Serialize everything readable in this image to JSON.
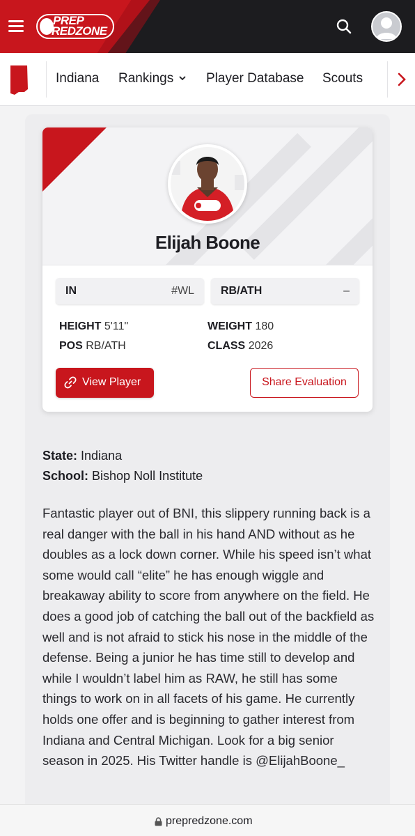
{
  "header": {
    "logo_line1": "PREP",
    "logo_line2": "REDZONE",
    "menu_icon": "hamburger-menu-icon",
    "search_icon": "search-icon",
    "avatar_icon": "user-avatar-icon"
  },
  "nav": {
    "state_icon": "indiana-state-icon",
    "items": [
      {
        "label": "Indiana"
      },
      {
        "label": "Rankings",
        "icon": "chevron-down-icon"
      },
      {
        "label": "Player Database"
      },
      {
        "label": "Scouts"
      }
    ],
    "next_icon": "chevron-right-icon"
  },
  "player": {
    "name": "Elijah Boone",
    "state_abbr": "IN",
    "state_rank": "#WL",
    "position_chip": "RB/ATH",
    "position_rank": "–",
    "height_label": "HEIGHT",
    "height": "5'11\"",
    "weight_label": "WEIGHT",
    "weight": "180",
    "pos_label": "POS",
    "pos": "RB/ATH",
    "class_label": "CLASS",
    "class": "2026",
    "jersey_text": "PREP REDZONE"
  },
  "actions": {
    "view_player": "View Player",
    "share_evaluation": "Share Evaluation"
  },
  "details": {
    "state_label": "State:",
    "state": "Indiana",
    "school_label": "School:",
    "school": "Bishop Noll Institute"
  },
  "evaluation": "Fantastic player out of BNI, this slippery running back is a real danger with the ball in his hand AND without as he doubles as a lock down corner. While his speed isn’t what some would call “elite” he has enough wiggle and breakaway ability to score from anywhere on the field. He does a good job of catching the ball out of the backfield as well and is not afraid to stick his nose in the middle of the defense. Being a junior he has time still to develop and while I wouldn’t label him as RAW, he still has some things to work on in all facets of his game. He currently holds one offer and is beginning to gather interest from Indiana and Central Michigan. Look for a big senior season in 2025. His Twitter handle is @ElijahBoone_",
  "browser": {
    "url": "prepredzone.com",
    "lock_icon": "lock-icon"
  },
  "colors": {
    "brand_red": "#c8161d",
    "header_dark": "#1c1c1f",
    "panel_gray": "#ededef"
  }
}
